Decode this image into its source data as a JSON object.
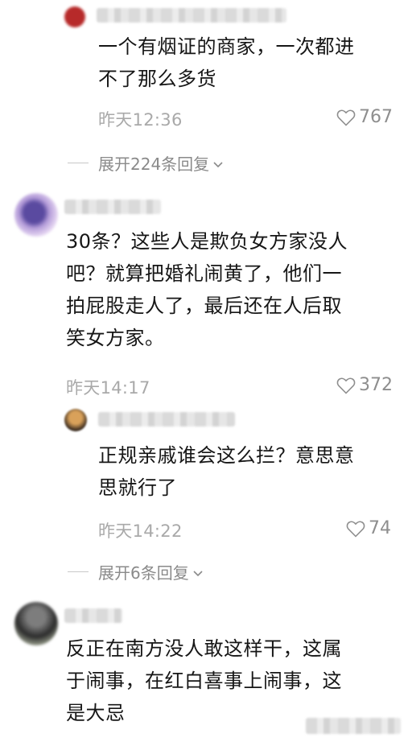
{
  "comments": {
    "reply1": {
      "text_line1": "一个有烟证的商家，一次都进",
      "text_line2": "不了那么多货",
      "time": "昨天12:36",
      "likes": "767"
    },
    "expand1": {
      "label": "展开224条回复"
    },
    "comment2": {
      "text_line1": "30条？这些人是欺负女方家没人",
      "text_line2": "吧？就算把婚礼闹黄了，他们一",
      "text_line3": "拍屁股走人了，最后还在人后取",
      "text_line4": "笑女方家。",
      "time": "昨天14:17",
      "likes": "372"
    },
    "reply2": {
      "text_line1": "正规亲戚谁会这么拦？意思意",
      "text_line2": "思就行了",
      "time": "昨天14:22",
      "likes": "74"
    },
    "expand2": {
      "label": "展开6条回复"
    },
    "comment3": {
      "text_line1": "反正在南方没人敢这样干，这属",
      "text_line2": "于闹事，在红白喜事上闹事，这",
      "text_line3": "是大忌"
    }
  },
  "icons": {
    "like": "heart-outline-icon",
    "expand": "chevron-down-icon"
  },
  "colors": {
    "text": "#161616",
    "meta": "#a9a9a9",
    "secondary": "#8a8a8a"
  }
}
